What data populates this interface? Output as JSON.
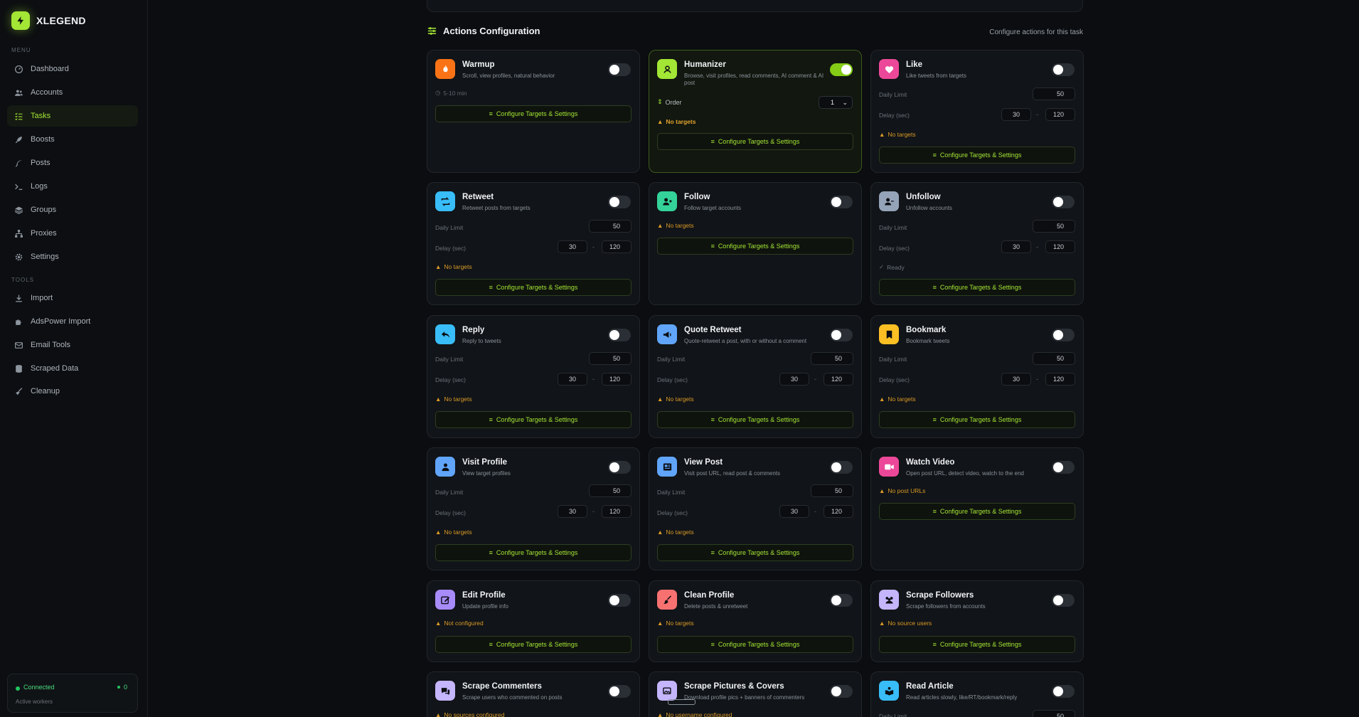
{
  "brand": {
    "name": "XLEGEND"
  },
  "sidebar": {
    "menu_label": "MENU",
    "tools_label": "TOOLS",
    "menu_items": [
      {
        "label": "Dashboard",
        "icon": "gauge-icon"
      },
      {
        "label": "Accounts",
        "icon": "users-icon"
      },
      {
        "label": "Tasks",
        "icon": "list-check-icon",
        "active": true
      },
      {
        "label": "Boosts",
        "icon": "rocket-icon"
      },
      {
        "label": "Posts",
        "icon": "feather-icon"
      },
      {
        "label": "Logs",
        "icon": "terminal-icon"
      },
      {
        "label": "Groups",
        "icon": "layers-icon"
      },
      {
        "label": "Proxies",
        "icon": "network-icon"
      },
      {
        "label": "Settings",
        "icon": "gear-icon"
      }
    ],
    "tool_items": [
      {
        "label": "Import",
        "icon": "import-icon"
      },
      {
        "label": "AdsPower Import",
        "icon": "puzzle-icon"
      },
      {
        "label": "Email Tools",
        "icon": "envelope-icon"
      },
      {
        "label": "Scraped Data",
        "icon": "database-icon"
      },
      {
        "label": "Cleanup",
        "icon": "broom-icon"
      }
    ],
    "status": {
      "label": "Connected",
      "count": "0",
      "sub": "Active workers"
    }
  },
  "section": {
    "title": "Actions Configuration",
    "subtitle": "Configure actions for this task"
  },
  "labels": {
    "daily_limit": "Daily Limit",
    "delay": "Delay (sec)",
    "configure": "Configure Targets & Settings",
    "order": "Order",
    "dash": "-"
  },
  "colors": {
    "accent": "#a3e635",
    "warning": "#d99a27"
  },
  "cards": {
    "warmup": {
      "title": "Warmup",
      "desc": "Scroll, view profiles, natural behavior",
      "meta": "5-10 min",
      "enabled": false,
      "icon": "fire-icon"
    },
    "humanizer": {
      "title": "Humanizer",
      "desc": "Browse, visit profiles, read comments, AI comment & AI post",
      "order": "1",
      "status": "No targets",
      "enabled": true,
      "icon": "user-shield-icon"
    },
    "like": {
      "title": "Like",
      "desc": "Like tweets from targets",
      "daily": "50",
      "min": "30",
      "max": "120",
      "status": "No targets",
      "enabled": false,
      "icon": "heart-icon"
    },
    "retweet": {
      "title": "Retweet",
      "desc": "Retweet posts from targets",
      "daily": "50",
      "min": "30",
      "max": "120",
      "status": "No targets",
      "enabled": false,
      "icon": "retweet-icon"
    },
    "follow": {
      "title": "Follow",
      "desc": "Follow target accounts",
      "status": "No targets",
      "enabled": false,
      "icon": "user-plus-icon"
    },
    "unfollow": {
      "title": "Unfollow",
      "desc": "Unfollow accounts",
      "daily": "50",
      "min": "30",
      "max": "120",
      "status": "Ready",
      "enabled": false,
      "icon": "user-minus-icon"
    },
    "reply": {
      "title": "Reply",
      "desc": "Reply to tweets",
      "daily": "50",
      "min": "30",
      "max": "120",
      "status": "No targets",
      "enabled": false,
      "icon": "reply-icon"
    },
    "quote": {
      "title": "Quote Retweet",
      "desc": "Quote-retweet a post, with or without a comment",
      "daily": "50",
      "min": "30",
      "max": "120",
      "status": "No targets",
      "enabled": false,
      "icon": "megaphone-icon"
    },
    "bookmark": {
      "title": "Bookmark",
      "desc": "Bookmark tweets",
      "daily": "50",
      "min": "30",
      "max": "120",
      "status": "No targets",
      "enabled": false,
      "icon": "bookmark-icon"
    },
    "visit": {
      "title": "Visit Profile",
      "desc": "View target profiles",
      "daily": "50",
      "min": "30",
      "max": "120",
      "status": "No targets",
      "enabled": false,
      "icon": "user-icon"
    },
    "viewpost": {
      "title": "View Post",
      "desc": "Visit post URL, read post & comments",
      "daily": "50",
      "min": "30",
      "max": "120",
      "status": "No targets",
      "enabled": false,
      "icon": "newspaper-icon"
    },
    "watch": {
      "title": "Watch Video",
      "desc": "Open post URL, detect video, watch to the end",
      "status": "No post URLs",
      "enabled": false,
      "icon": "video-icon"
    },
    "edit": {
      "title": "Edit Profile",
      "desc": "Update profile info",
      "status": "Not configured",
      "enabled": false,
      "icon": "edit-icon"
    },
    "clean": {
      "title": "Clean Profile",
      "desc": "Delete posts & unretweet",
      "status": "No targets",
      "enabled": false,
      "icon": "brush-icon"
    },
    "scrapefol": {
      "title": "Scrape Followers",
      "desc": "Scrape followers from accounts",
      "status": "No source users",
      "enabled": false,
      "icon": "users-group-icon"
    },
    "scrapecom": {
      "title": "Scrape Commenters",
      "desc": "Scrape users who commented on posts",
      "status": "No sources configured",
      "enabled": false,
      "icon": "comments-icon"
    },
    "scrapepic": {
      "title": "Scrape Pictures & Covers",
      "desc": "Download profile pics + banners of commenters",
      "status": "No username configured",
      "enabled": false,
      "icon": "images-icon"
    },
    "article": {
      "title": "Read Article",
      "desc": "Read articles slowly, like/RT/bookmark/reply",
      "daily": "50",
      "enabled": false,
      "icon": "book-reader-icon"
    }
  }
}
